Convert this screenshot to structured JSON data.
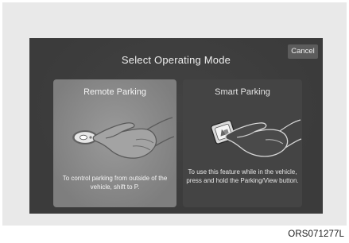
{
  "dialog": {
    "title": "Select Operating Mode",
    "cancel_label": "Cancel"
  },
  "options": [
    {
      "label": "Remote Parking",
      "description": "To control parking from outside of the vehicle, shift to P.",
      "icon": "remote-key-hand-icon",
      "selected": true
    },
    {
      "label": "Smart Parking",
      "description": "To use this feature while in the vehicle, press and hold the Parking/View button.",
      "icon": "parking-button-hand-icon",
      "selected": false
    }
  ],
  "image_code": "ORS071277L",
  "colors": {
    "screen_bg": "#3b3b3b",
    "selected_tile": "#8a8a8a",
    "unselected_tile": "#444444",
    "frame_bg": "#e9e9e9"
  }
}
